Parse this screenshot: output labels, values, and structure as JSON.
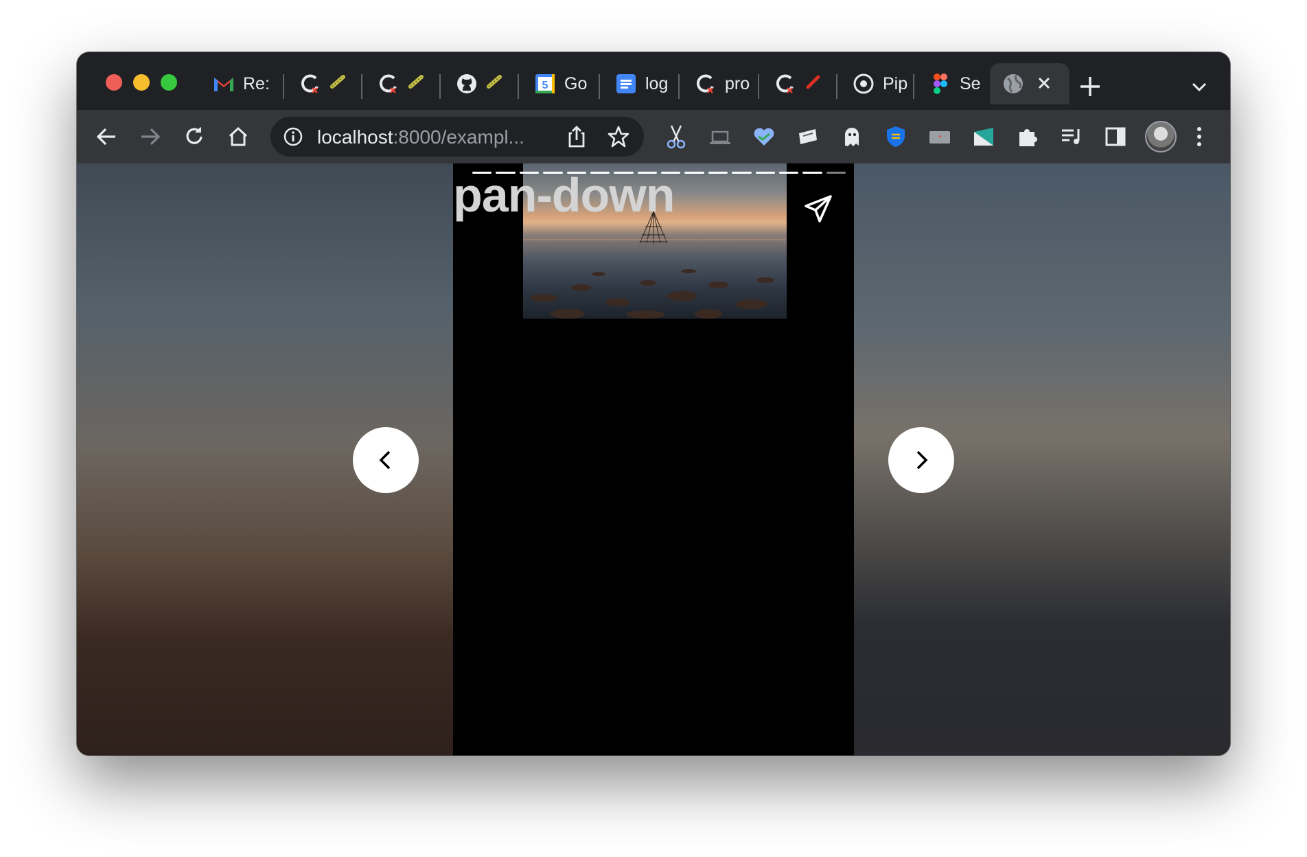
{
  "browser": {
    "tabs": [
      {
        "title": "Re:",
        "icon": "gmail-icon"
      },
      {
        "title": "",
        "icon": "git-icon"
      },
      {
        "title": "",
        "icon": "git-icon"
      },
      {
        "title": "",
        "icon": "github-icon"
      },
      {
        "title": "Go",
        "icon": "calendar-icon"
      },
      {
        "title": "log",
        "icon": "docs-icon"
      },
      {
        "title": "pro",
        "icon": "git-icon"
      },
      {
        "title": "",
        "icon": "git-icon"
      },
      {
        "title": "Pip",
        "icon": "pip-icon"
      },
      {
        "title": "Se",
        "icon": "figma-icon"
      },
      {
        "title": "",
        "icon": "globe-icon",
        "active": true
      }
    ],
    "calendar_day": "5",
    "url_host": "localhost",
    "url_path": ":8000/exampl..."
  },
  "story": {
    "title": "pan-down",
    "progress_segments": 16,
    "colors": {
      "accent": "#ffffff",
      "story_bg": "#000000"
    }
  }
}
